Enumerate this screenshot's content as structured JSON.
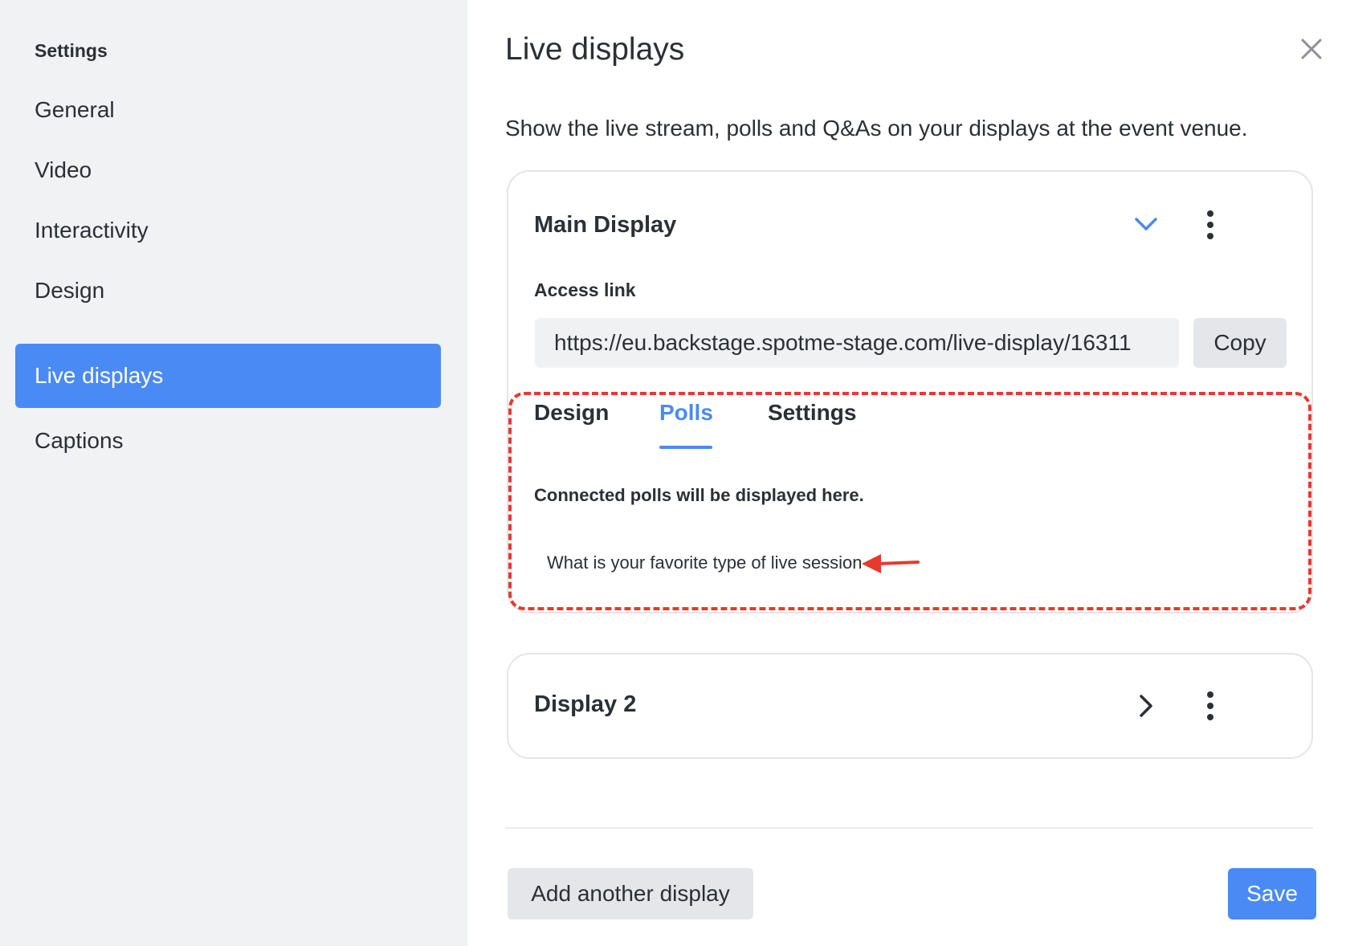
{
  "sidebar": {
    "title": "Settings",
    "items": [
      {
        "label": "General",
        "active": false
      },
      {
        "label": "Video",
        "active": false
      },
      {
        "label": "Interactivity",
        "active": false
      },
      {
        "label": "Design",
        "active": false
      },
      {
        "label": "Live displays",
        "active": true
      },
      {
        "label": "Captions",
        "active": false
      }
    ]
  },
  "main": {
    "title": "Live displays",
    "subtitle": "Show the live stream, polls and Q&As on your displays at the event venue.",
    "close_icon": "close-icon",
    "displays": [
      {
        "name": "Main Display",
        "expanded": true,
        "access_label": "Access link",
        "access_link": "https://eu.backstage.spotme-stage.com/live-display/16311",
        "copy_label": "Copy",
        "tabs": [
          {
            "label": "Design",
            "active": false
          },
          {
            "label": "Polls",
            "active": true
          },
          {
            "label": "Settings",
            "active": false
          }
        ],
        "polls_heading": "Connected polls will be displayed here.",
        "polls": [
          "What is your favorite type of live session"
        ]
      },
      {
        "name": "Display 2",
        "expanded": false
      }
    ],
    "add_button_label": "Add another display",
    "save_button_label": "Save"
  },
  "colors": {
    "accent": "#4a8af4",
    "annotation": "#e63a2e",
    "sidebar_bg": "#f1f2f4"
  }
}
